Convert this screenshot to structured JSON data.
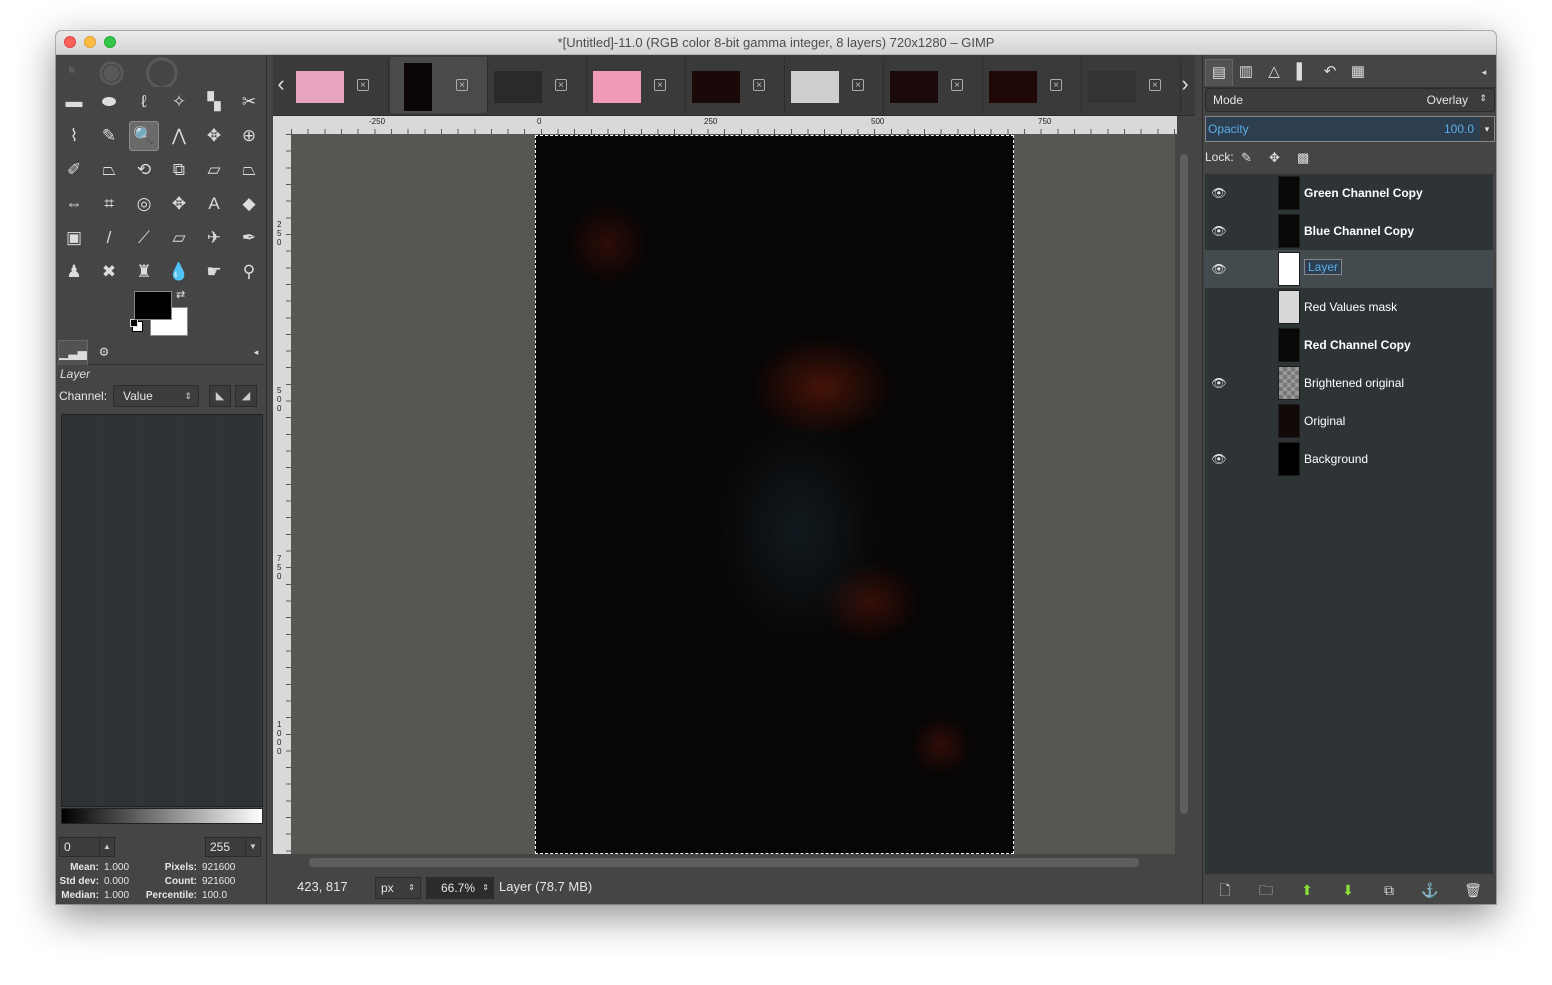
{
  "window": {
    "title": "*[Untitled]-11.0 (RGB color 8-bit gamma integer, 8 layers) 720x1280 – GIMP"
  },
  "toolbox": {
    "tools": [
      {
        "name": "rect-select-icon",
        "glyph": "▬"
      },
      {
        "name": "ellipse-select-icon",
        "glyph": "⬬"
      },
      {
        "name": "free-select-icon",
        "glyph": "ℓ"
      },
      {
        "name": "fuzzy-select-icon",
        "glyph": "✧"
      },
      {
        "name": "select-by-color-icon",
        "glyph": "▚"
      },
      {
        "name": "scissors-select-icon",
        "glyph": "✂"
      },
      {
        "name": "foreground-select-icon",
        "glyph": "⌇"
      },
      {
        "name": "paths-icon",
        "glyph": "✎"
      },
      {
        "name": "zoom-icon",
        "glyph": "🔍"
      },
      {
        "name": "measure-icon",
        "glyph": "⋀"
      },
      {
        "name": "move-icon",
        "glyph": "✥"
      },
      {
        "name": "align-icon",
        "glyph": "⊕"
      },
      {
        "name": "color-picker-icon",
        "glyph": "✐"
      },
      {
        "name": "crop-icon",
        "glyph": "⏢"
      },
      {
        "name": "rotate-icon",
        "glyph": "⟲"
      },
      {
        "name": "scale-icon",
        "glyph": "⧉"
      },
      {
        "name": "shear-icon",
        "glyph": "⏥"
      },
      {
        "name": "perspective-icon",
        "glyph": "⏢"
      },
      {
        "name": "flip-icon",
        "glyph": "⇔"
      },
      {
        "name": "cage-icon",
        "glyph": "⌗"
      },
      {
        "name": "warp-icon",
        "glyph": "◎"
      },
      {
        "name": "unified-transform-icon",
        "glyph": "✥"
      },
      {
        "name": "text-icon",
        "glyph": "A"
      },
      {
        "name": "bucket-fill-icon",
        "glyph": "◆"
      },
      {
        "name": "blend-icon",
        "glyph": "▣"
      },
      {
        "name": "pencil-icon",
        "glyph": "/"
      },
      {
        "name": "paintbrush-icon",
        "glyph": "⟋"
      },
      {
        "name": "eraser-icon",
        "glyph": "▱"
      },
      {
        "name": "airbrush-icon",
        "glyph": "✈"
      },
      {
        "name": "ink-icon",
        "glyph": "✒"
      },
      {
        "name": "clone-icon",
        "glyph": "♟"
      },
      {
        "name": "heal-icon",
        "glyph": "✖"
      },
      {
        "name": "perspective-clone-icon",
        "glyph": "♜"
      },
      {
        "name": "blur-icon",
        "glyph": "💧"
      },
      {
        "name": "smudge-icon",
        "glyph": "☛"
      },
      {
        "name": "dodge-burn-icon",
        "glyph": "⚲"
      }
    ],
    "active_tool": 8,
    "colors": {
      "fg": "#000000",
      "bg": "#ffffff"
    }
  },
  "histogram": {
    "title": "Layer",
    "channel_label": "Channel:",
    "channel_value": "Value",
    "range_min": "0",
    "range_max": "255",
    "stats": {
      "mean_label": "Mean:",
      "mean": "1.000",
      "stddev_label": "Std dev:",
      "stddev": "0.000",
      "median_label": "Median:",
      "median": "1.000",
      "pixels_label": "Pixels:",
      "pixels": "921600",
      "count_label": "Count:",
      "count": "921600",
      "percentile_label": "Percentile:",
      "percentile": "100.0"
    }
  },
  "image_tabs": [
    {
      "name": "image-tab-1",
      "color": "#e8a3c0"
    },
    {
      "name": "image-tab-2",
      "color": "#0b0505"
    },
    {
      "name": "image-tab-3",
      "color": "#2a2a2a"
    },
    {
      "name": "image-tab-4",
      "color": "#ef9ab8"
    },
    {
      "name": "image-tab-5",
      "color": "#1a0909"
    },
    {
      "name": "image-tab-6",
      "color": "#cfcfcf"
    },
    {
      "name": "image-tab-7",
      "color": "#1a0a0a"
    },
    {
      "name": "image-tab-8",
      "color": "#200808"
    },
    {
      "name": "image-tab-9",
      "color": "#333333"
    }
  ],
  "rulers": {
    "top": [
      "-250",
      "0",
      "250",
      "500",
      "750"
    ],
    "left": [
      "250",
      "500",
      "750",
      "1000"
    ]
  },
  "status": {
    "coords": "423, 817",
    "unit": "px",
    "zoom": "66.7%",
    "layer_info": "Layer (78.7 MB)"
  },
  "layers_panel": {
    "mode_label": "Mode",
    "mode_value": "Overlay",
    "opacity_label": "Opacity",
    "opacity_value": "100.0",
    "lock_label": "Lock:",
    "layers": [
      {
        "name": "Green Channel Copy",
        "visible": true,
        "bold": true,
        "thumb": "#0a0707"
      },
      {
        "name": "Blue Channel Copy",
        "visible": true,
        "bold": true,
        "thumb": "#0a0707"
      },
      {
        "name": "Layer",
        "visible": true,
        "bold": false,
        "thumb": "#ffffff",
        "selected": true,
        "editing": true
      },
      {
        "name": "Red Values mask",
        "visible": false,
        "bold": false,
        "thumb": "#d8d8d8"
      },
      {
        "name": "Red Channel Copy",
        "visible": false,
        "bold": true,
        "thumb": "#0a0707"
      },
      {
        "name": "Brightened original",
        "visible": true,
        "bold": false,
        "thumb": "#8a8a8a"
      },
      {
        "name": "Original",
        "visible": false,
        "bold": false,
        "thumb": "#120808"
      },
      {
        "name": "Background",
        "visible": true,
        "bold": false,
        "thumb": "#000000"
      }
    ]
  }
}
